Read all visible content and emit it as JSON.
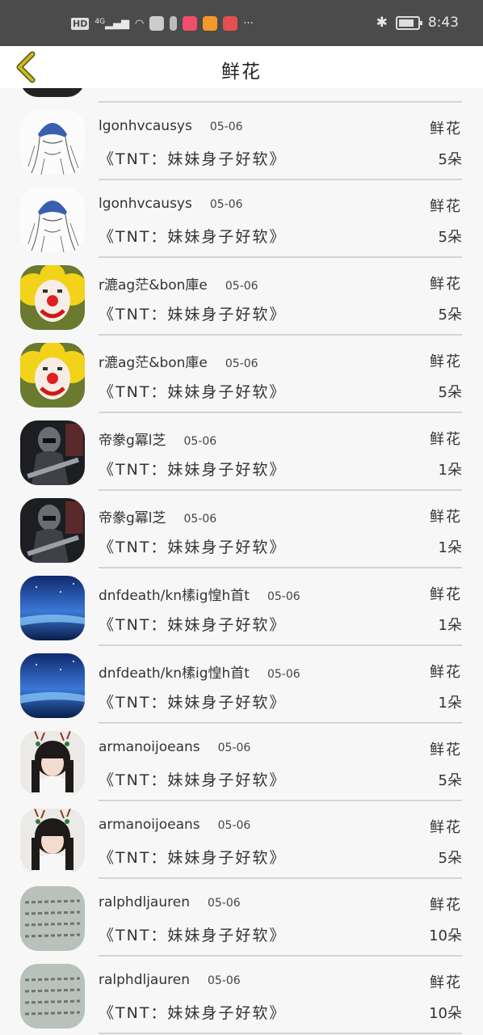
{
  "status_bar": {
    "left_icons": [
      "hd-icon",
      "signal-4g-icon",
      "wifi-icon",
      "app-icon",
      "battery-saver-icon",
      "app-kuaishou-icon",
      "app-video-icon",
      "app-game-icon"
    ],
    "hd": "HD",
    "network": "4G",
    "more": "···",
    "time": "8:43"
  },
  "header": {
    "title": "鲜花"
  },
  "colors": {
    "header_bg": "#ffffff",
    "status_bg": "#4b4b4b",
    "back_arrow": "#c4b41f",
    "divider": "#d4d4d4"
  },
  "records": [
    {
      "user": "lgonhvcausys",
      "date": "05-06",
      "gift": "《TNT：妹妹身子好软》",
      "type": "鲜花",
      "count": "5朵",
      "avatar": "sketch-avatar"
    },
    {
      "user": "lgonhvcausys",
      "date": "05-06",
      "gift": "《TNT：妹妹身子好软》",
      "type": "鲜花",
      "count": "5朵",
      "avatar": "sketch-avatar"
    },
    {
      "user": "r漉ag茫&bon庫e",
      "date": "05-06",
      "gift": "《TNT：妹妹身子好软》",
      "type": "鲜花",
      "count": "5朵",
      "avatar": "clown-avatar"
    },
    {
      "user": "r漉ag茫&bon庫e",
      "date": "05-06",
      "gift": "《TNT：妹妹身子好软》",
      "type": "鲜花",
      "count": "5朵",
      "avatar": "clown-avatar"
    },
    {
      "user": "帝豢g冪l芝",
      "date": "05-06",
      "gift": "《TNT：妹妹身子好软》",
      "type": "鲜花",
      "count": "1朵",
      "avatar": "soldier-avatar"
    },
    {
      "user": "帝豢g冪l芝",
      "date": "05-06",
      "gift": "《TNT：妹妹身子好软》",
      "type": "鲜花",
      "count": "1朵",
      "avatar": "soldier-avatar"
    },
    {
      "user": "dnfdeath/kn榡ig惶h首t",
      "date": "05-06",
      "gift": "《TNT：妹妹身子好软》",
      "type": "鲜花",
      "count": "1朵",
      "avatar": "night-sky-avatar"
    },
    {
      "user": "dnfdeath/kn榡ig惶h首t",
      "date": "05-06",
      "gift": "《TNT：妹妹身子好软》",
      "type": "鲜花",
      "count": "1朵",
      "avatar": "night-sky-avatar"
    },
    {
      "user": "armanoijoeans",
      "date": "05-06",
      "gift": "《TNT：妹妹身子好软》",
      "type": "鲜花",
      "count": "5朵",
      "avatar": "girl-avatar"
    },
    {
      "user": "armanoijoeans",
      "date": "05-06",
      "gift": "《TNT：妹妹身子好软》",
      "type": "鲜花",
      "count": "5朵",
      "avatar": "girl-avatar"
    },
    {
      "user": "ralphdljauren",
      "date": "05-06",
      "gift": "《TNT：妹妹身子好软》",
      "type": "鲜花",
      "count": "10朵",
      "avatar": "handwriting-avatar"
    },
    {
      "user": "ralphdljauren",
      "date": "05-06",
      "gift": "《TNT：妹妹身子好软》",
      "type": "鲜花",
      "count": "10朵",
      "avatar": "handwriting-avatar"
    }
  ]
}
